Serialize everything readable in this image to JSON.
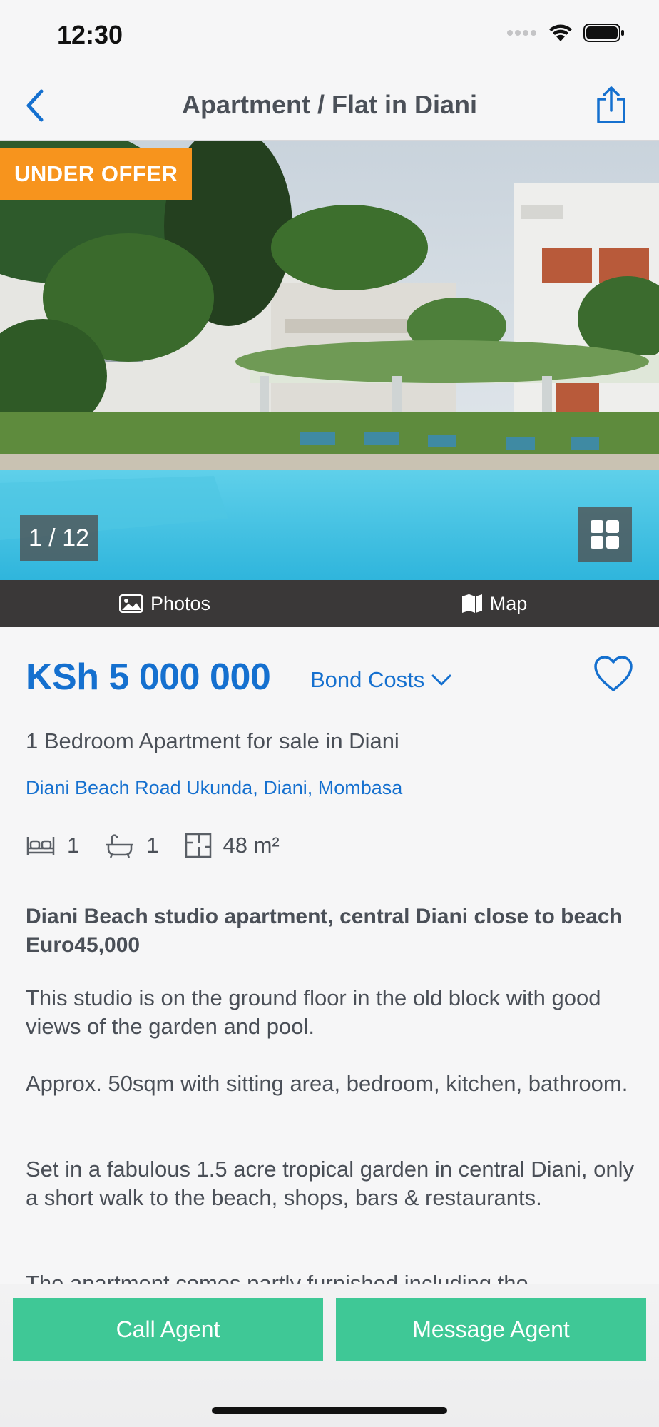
{
  "status_bar": {
    "time": "12:30"
  },
  "nav": {
    "title": "Apartment / Flat in Diani"
  },
  "hero": {
    "badge": "UNDER OFFER",
    "photo_counter": "1 / 12"
  },
  "media_tabs": [
    {
      "label": "Photos",
      "icon": "image-icon"
    },
    {
      "label": "Map",
      "icon": "map-icon"
    }
  ],
  "listing": {
    "price": "KSh 5 000 000",
    "bond_costs": "Bond Costs",
    "subtitle": "1 Bedroom Apartment for sale in Diani",
    "address": "Diani Beach Road Ukunda, Diani, Mombasa",
    "features": {
      "bedrooms": "1",
      "bathrooms": "1",
      "floor_size": "48 m²"
    },
    "headline": "Diani Beach studio apartment, central Diani close to beach Euro45,000",
    "paragraphs": [
      "This studio is on the ground floor in the old block with good views of the garden and pool.",
      "Approx. 50sqm with sitting area, bedroom, kitchen, bathroom.",
      "Set in a fabulous 1.5 acre tropical garden in central Diani, only a short walk to the beach, shops, bars & restaurants.",
      "The apartment comes partly furnished including the"
    ]
  },
  "actions": {
    "call": "Call Agent",
    "message": "Message Agent"
  },
  "colors": {
    "accent": "#1570cf",
    "cta": "#3fc896",
    "badge": "#f7941d",
    "tab_bar": "#3a3838"
  }
}
